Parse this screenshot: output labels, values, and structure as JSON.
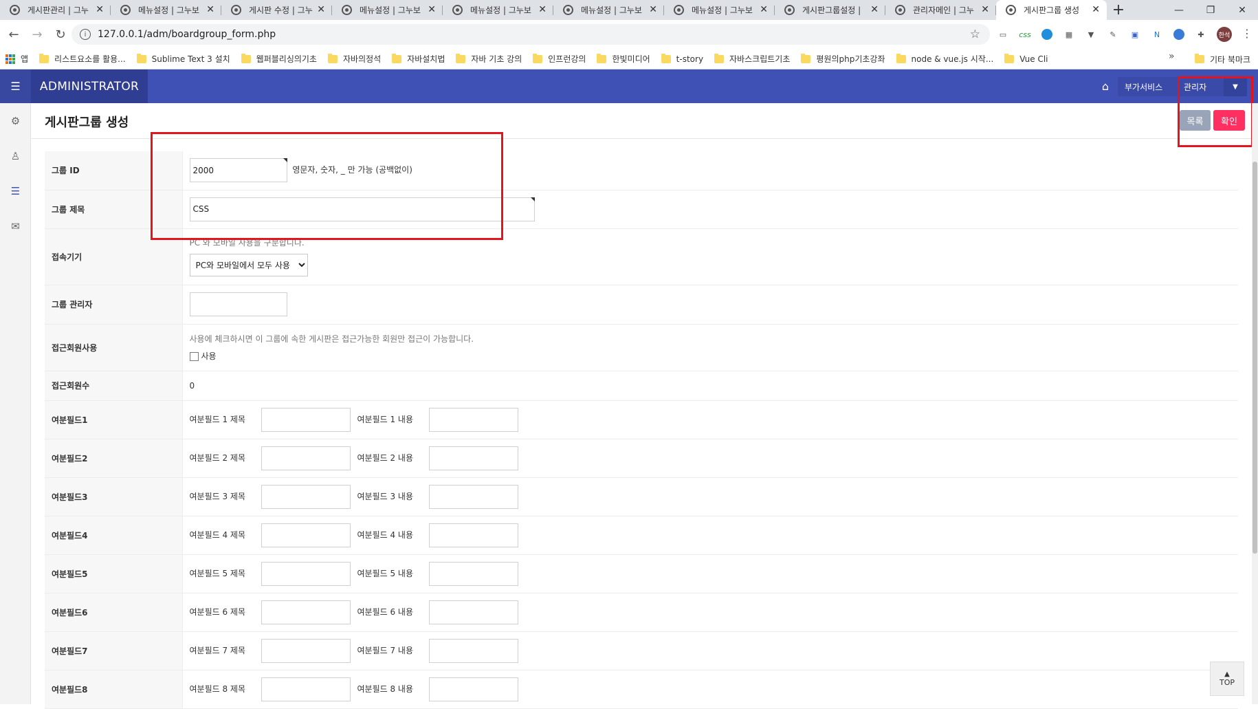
{
  "browser": {
    "tabs": [
      {
        "label": "게시판관리 | 그누"
      },
      {
        "label": "메뉴설정 | 그누보"
      },
      {
        "label": "게시판 수정 | 그누"
      },
      {
        "label": "메뉴설정 | 그누보"
      },
      {
        "label": "메뉴설정 | 그누보"
      },
      {
        "label": "메뉴설정 | 그누보"
      },
      {
        "label": "메뉴설정 | 그누보"
      },
      {
        "label": "게시판그룹설정 |"
      },
      {
        "label": "관리자메인 | 그누"
      },
      {
        "label": "게시판그룹 생성"
      }
    ],
    "url": "127.0.0.1/adm/boardgroup_form.php",
    "profile_label": "한석",
    "extensions": [
      "css"
    ],
    "bookmarks": [
      {
        "label": "앱",
        "type": "apps"
      },
      {
        "label": "리스트요소를 활용...",
        "type": "folder"
      },
      {
        "label": "Sublime Text 3 설치",
        "type": "folder"
      },
      {
        "label": "웹퍼블리싱의기초",
        "type": "folder"
      },
      {
        "label": "자바의정석",
        "type": "folder"
      },
      {
        "label": "자바설치법",
        "type": "folder"
      },
      {
        "label": "자바 기초 강의",
        "type": "folder"
      },
      {
        "label": "인프런강의",
        "type": "folder"
      },
      {
        "label": "한빛미디어",
        "type": "folder"
      },
      {
        "label": "t-story",
        "type": "folder"
      },
      {
        "label": "자바스크립트기초",
        "type": "folder"
      },
      {
        "label": "평원의php기초강좌",
        "type": "folder"
      },
      {
        "label": "node & vue.js 시작...",
        "type": "folder"
      },
      {
        "label": "Vue Cli",
        "type": "folder"
      }
    ],
    "bookmarks_more": "»",
    "bookmarks_other": "기타 북마크"
  },
  "header": {
    "brand": "ADMINISTRATOR",
    "service_button": "부가서비스",
    "admin_button": "관리자",
    "accent": "#3f51b5"
  },
  "page": {
    "title": "게시판그룹 생성",
    "list_button": "목록",
    "ok_button": "확인"
  },
  "form": {
    "group_id": {
      "label": "그룹 ID",
      "value": "2000",
      "help": "영문자, 숫자, _ 만 가능 (공백없이)"
    },
    "group_title": {
      "label": "그룹 제목",
      "value": "CSS"
    },
    "device": {
      "label": "접속기기",
      "help": "PC 와 모바일 사용을 구분합니다.",
      "selected": "PC와 모바일에서 모두 사용"
    },
    "group_admin": {
      "label": "그룹 관리자",
      "value": ""
    },
    "access_member": {
      "label": "접근회원사용",
      "help": "사용에 체크하시면 이 그룹에 속한 게시판은 접근가능한 회원만 접근이 가능합니다.",
      "checkbox_label": "사용"
    },
    "access_count": {
      "label": "접근회원수",
      "value": "0"
    },
    "extra_fields": [
      {
        "label": "여분필드1",
        "title_label": "여분필드 1 제목",
        "content_label": "여분필드 1 내용"
      },
      {
        "label": "여분필드2",
        "title_label": "여분필드 2 제목",
        "content_label": "여분필드 2 내용"
      },
      {
        "label": "여분필드3",
        "title_label": "여분필드 3 제목",
        "content_label": "여분필드 3 내용"
      },
      {
        "label": "여분필드4",
        "title_label": "여분필드 4 제목",
        "content_label": "여분필드 4 내용"
      },
      {
        "label": "여분필드5",
        "title_label": "여분필드 5 제목",
        "content_label": "여분필드 5 내용"
      },
      {
        "label": "여분필드6",
        "title_label": "여분필드 6 제목",
        "content_label": "여분필드 6 내용"
      },
      {
        "label": "여분필드7",
        "title_label": "여분필드 7 제목",
        "content_label": "여분필드 7 내용"
      },
      {
        "label": "여분필드8",
        "title_label": "여분필드 8 제목",
        "content_label": "여분필드 8 내용"
      }
    ]
  },
  "top_button": "TOP"
}
